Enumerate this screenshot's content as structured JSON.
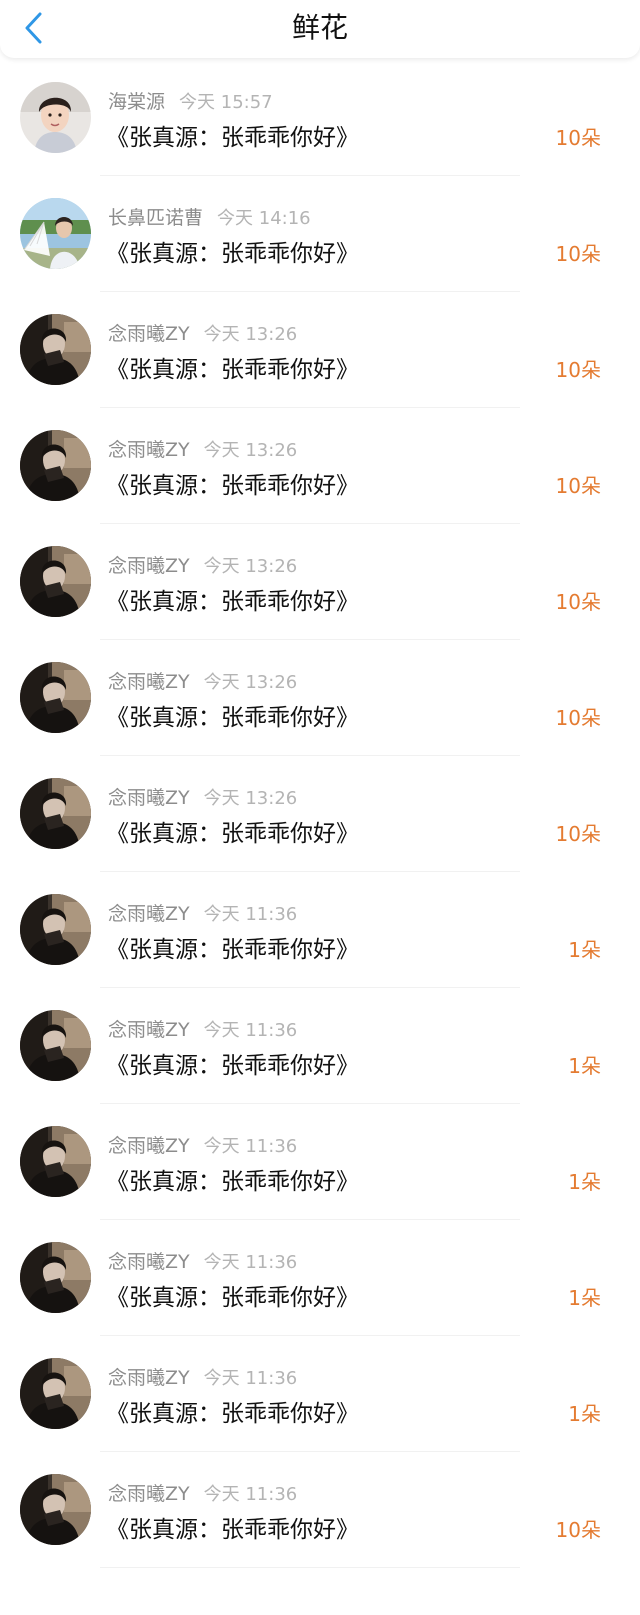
{
  "header": {
    "title": "鲜花",
    "back_icon": "chevron-left-icon",
    "accent_color": "#2f97e6"
  },
  "flower_color": "#e47b31",
  "items": [
    {
      "user": "海棠源",
      "time": "今天 15:57",
      "title": "《张真源：张乖乖你好》",
      "count": "10朵",
      "avatar": "boy-portrait"
    },
    {
      "user": "长鼻匹诺曹",
      "time": "今天 14:16",
      "title": "《张真源：张乖乖你好》",
      "count": "10朵",
      "avatar": "fan-outdoor-photo"
    },
    {
      "user": "念雨曦ZY",
      "time": "今天 13:26",
      "title": "《张真源：张乖乖你好》",
      "count": "10朵",
      "avatar": "dark-portrait"
    },
    {
      "user": "念雨曦ZY",
      "time": "今天 13:26",
      "title": "《张真源：张乖乖你好》",
      "count": "10朵",
      "avatar": "dark-portrait"
    },
    {
      "user": "念雨曦ZY",
      "time": "今天 13:26",
      "title": "《张真源：张乖乖你好》",
      "count": "10朵",
      "avatar": "dark-portrait"
    },
    {
      "user": "念雨曦ZY",
      "time": "今天 13:26",
      "title": "《张真源：张乖乖你好》",
      "count": "10朵",
      "avatar": "dark-portrait"
    },
    {
      "user": "念雨曦ZY",
      "time": "今天 13:26",
      "title": "《张真源：张乖乖你好》",
      "count": "10朵",
      "avatar": "dark-portrait"
    },
    {
      "user": "念雨曦ZY",
      "time": "今天 11:36",
      "title": "《张真源：张乖乖你好》",
      "count": "1朵",
      "avatar": "dark-portrait"
    },
    {
      "user": "念雨曦ZY",
      "time": "今天 11:36",
      "title": "《张真源：张乖乖你好》",
      "count": "1朵",
      "avatar": "dark-portrait"
    },
    {
      "user": "念雨曦ZY",
      "time": "今天 11:36",
      "title": "《张真源：张乖乖你好》",
      "count": "1朵",
      "avatar": "dark-portrait"
    },
    {
      "user": "念雨曦ZY",
      "time": "今天 11:36",
      "title": "《张真源：张乖乖你好》",
      "count": "1朵",
      "avatar": "dark-portrait"
    },
    {
      "user": "念雨曦ZY",
      "time": "今天 11:36",
      "title": "《张真源：张乖乖你好》",
      "count": "1朵",
      "avatar": "dark-portrait"
    },
    {
      "user": "念雨曦ZY",
      "time": "今天 11:36",
      "title": "《张真源：张乖乖你好》",
      "count": "10朵",
      "avatar": "dark-portrait"
    }
  ]
}
